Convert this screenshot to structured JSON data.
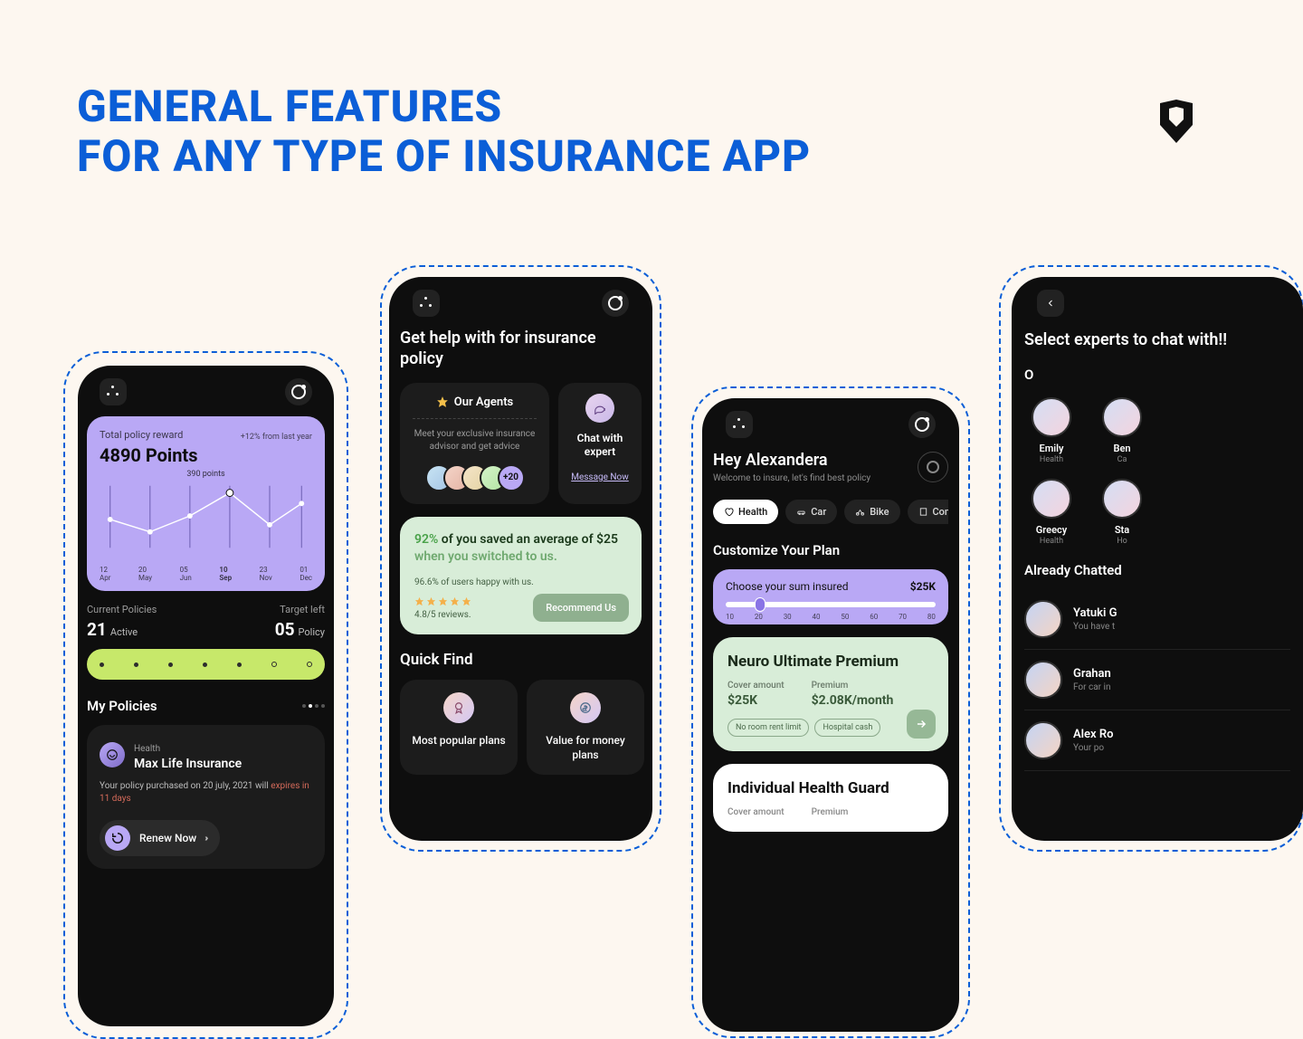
{
  "title_line1": "GENERAL FEATURES",
  "title_line2": "FOR ANY TYPE OF INSURANCE APP",
  "phone1": {
    "reward_label": "Total policy reward",
    "reward_value": "4890 Points",
    "reward_delta": "+12% from last year",
    "chart_marker": "390 points",
    "months": [
      {
        "d": "12",
        "m": "Apr"
      },
      {
        "d": "20",
        "m": "May"
      },
      {
        "d": "05",
        "m": "Jun"
      },
      {
        "d": "10",
        "m": "Sep"
      },
      {
        "d": "23",
        "m": "Nov"
      },
      {
        "d": "01",
        "m": "Dec"
      }
    ],
    "selected_month_index": 3,
    "current_label": "Current Policies",
    "target_label": "Target left",
    "active_n": "21",
    "active_t": "Active",
    "policy_n": "05",
    "policy_t": "Policy",
    "section": "My Policies",
    "policy": {
      "cat": "Health",
      "name": "Max Life Insurance",
      "note": "Your policy purchased on 20 july, 2021 will",
      "expire": "expires in 11 days",
      "renew": "Renew Now"
    }
  },
  "phone2": {
    "title": "Get help with for insurance policy",
    "agents": {
      "title": "Our Agents",
      "sub": "Meet your exclusive insurance advisor and get advice",
      "more": "+20"
    },
    "chat": {
      "title": "Chat with expert",
      "link": "Message Now"
    },
    "savings": {
      "pct": "92%",
      "mid": " of you saved an average of $25 ",
      "tail": "when you switched to us.",
      "happy": "96.6% of users happy with us.",
      "reviews": "4.8/5 reviews.",
      "cta": "Recommend Us"
    },
    "quick_title": "Quick Find",
    "q1": "Most popular plans",
    "q2": "Value for money plans"
  },
  "phone3": {
    "greet": "Hey Alexandera",
    "sub": "Welcome to insure, let's find best policy",
    "tabs": [
      "Health",
      "Car",
      "Bike",
      "Comme"
    ],
    "customize": "Customize Your Plan",
    "slider_label": "Choose your sum insured",
    "slider_value": "$25K",
    "ticks": [
      "10",
      "20",
      "30",
      "40",
      "50",
      "60",
      "70",
      "80"
    ],
    "plan1": {
      "name": "Neuro Ultimate Premium",
      "cover_l": "Cover amount",
      "cover_v": "$25K",
      "prem_l": "Premium",
      "prem_v": "$2.08K/month",
      "chips": [
        "No room rent limit",
        "Hospital cash"
      ]
    },
    "plan2": {
      "name": "Individual Health Guard",
      "cover_l": "Cover amount",
      "prem_l": "Premium"
    }
  },
  "phone4": {
    "title": "Select experts to chat with!!",
    "online": "O",
    "experts": [
      {
        "name": "Emily",
        "cat": "Health"
      },
      {
        "name": "Ben",
        "cat": "Ca"
      },
      {
        "name": "Greecy",
        "cat": "Health"
      },
      {
        "name": "Sta",
        "cat": "Ho"
      }
    ],
    "already": "Already Chatted",
    "chats": [
      {
        "name": "Yatuki G",
        "sub": "You have t"
      },
      {
        "name": "Grahan",
        "sub": "For car in"
      },
      {
        "name": "Alex Ro",
        "sub": "Your po"
      }
    ]
  },
  "chart_data": {
    "type": "line",
    "title": "Total policy reward",
    "categories": [
      "12 Apr",
      "20 May",
      "05 Jun",
      "10 Sep",
      "23 Nov",
      "01 Dec"
    ],
    "values": [
      260,
      200,
      280,
      390,
      240,
      340
    ],
    "ylabel": "points",
    "ylim": [
      0,
      400
    ],
    "highlight_index": 3,
    "highlight_label": "390 points"
  }
}
